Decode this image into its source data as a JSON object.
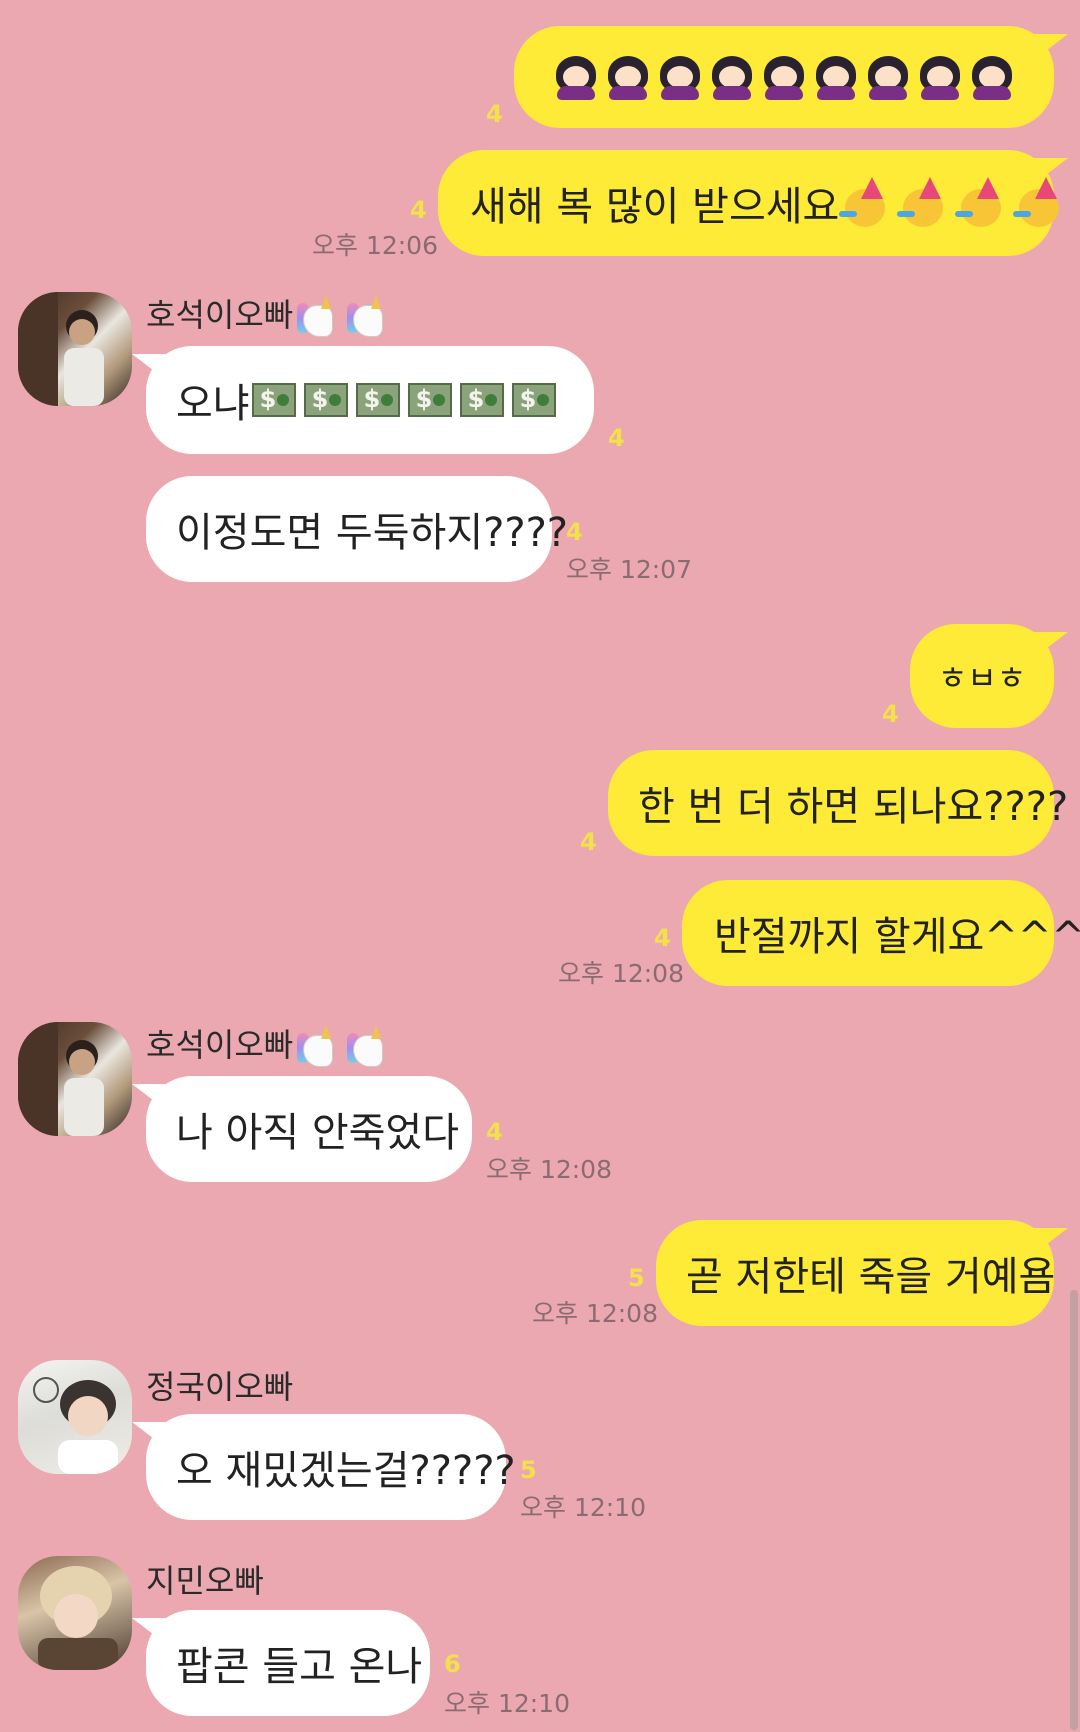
{
  "messages": {
    "m1": {
      "emoji_count": 9,
      "emoji_name": "girl-emoji",
      "unread": "4"
    },
    "m2": {
      "text": "새해 복 많이 받으세요",
      "emoji_count": 4,
      "emoji_name": "party-face-emoji",
      "unread": "4",
      "time": "오후 12:06"
    },
    "m3": {
      "sender": "호석이오빠",
      "text": "오냐",
      "emoji_count": 6,
      "emoji_name": "money-emoji",
      "unread": "4"
    },
    "m4": {
      "text": "이정도면 두둑하지????",
      "unread": "4",
      "time": "오후 12:07"
    },
    "m5": {
      "text": "ㅎㅂㅎ",
      "unread": "4"
    },
    "m6": {
      "text": "한 번 더 하면 되나요????",
      "unread": "4"
    },
    "m7": {
      "text": "반절까지 할게요^^^",
      "unread": "4",
      "time": "오후 12:08"
    },
    "m8": {
      "sender": "호석이오빠",
      "text": "나 아직 안죽었다",
      "unread": "4",
      "time": "오후 12:08"
    },
    "m9": {
      "text": "곧 저한테 죽을 거예욤",
      "unread": "5",
      "time": "오후 12:08"
    },
    "m10": {
      "sender": "정국이오빠",
      "text": "오 재밌겠는걸?????",
      "unread": "5",
      "time": "오후 12:10"
    },
    "m11": {
      "sender": "지민오빠",
      "text": "팝콘 들고 온나",
      "unread": "6",
      "time": "오후 12:10"
    }
  },
  "name_emoji": {
    "name": "unicorn-emoji",
    "count": 2
  },
  "colors": {
    "background": "#eba8b0",
    "my_bubble": "#fdeb37",
    "their_bubble": "#ffffff",
    "unread": "#f2e14a",
    "time": "#8b6b72"
  }
}
